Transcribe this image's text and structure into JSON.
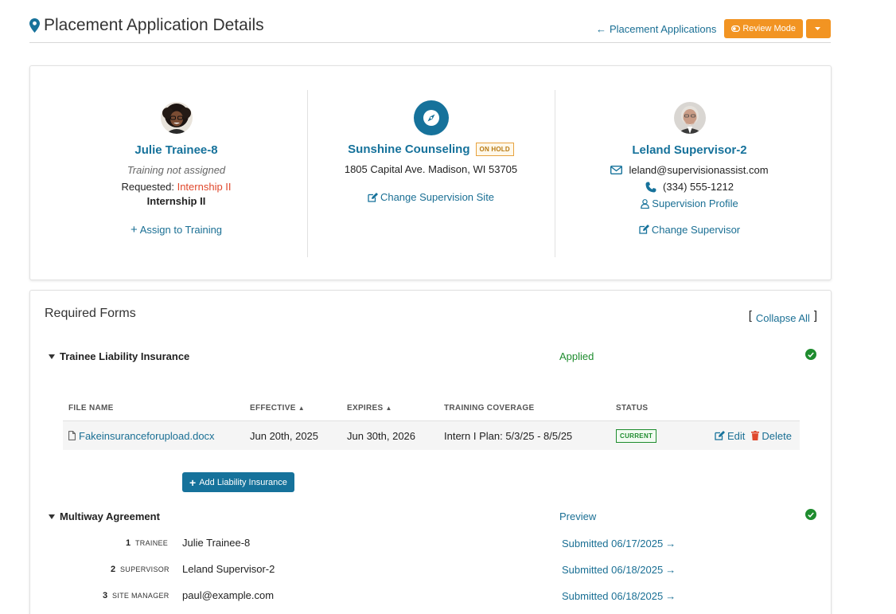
{
  "header": {
    "title": "Placement Application Details",
    "back_link": "Placement Applications",
    "review_mode_label": "Review Mode"
  },
  "trainee": {
    "name": "Julie Trainee-8",
    "training_status": "Training not assigned",
    "requested_label": "Requested:",
    "requested_value": "Internship II",
    "program": "Internship II",
    "assign_link": "Assign to Training"
  },
  "site": {
    "name": "Sunshine Counseling",
    "status_badge": "ON HOLD",
    "address": "1805 Capital Ave. Madison, WI 53705",
    "change_link": "Change Supervision Site"
  },
  "supervisor": {
    "name": "Leland Supervisor-2",
    "email": "leland@supervisionassist.com",
    "phone": "(334) 555-1212",
    "profile_link": "Supervision Profile",
    "change_link": "Change Supervisor"
  },
  "forms": {
    "title": "Required Forms",
    "collapse_all": "Collapse All",
    "liability": {
      "title": "Trainee Liability Insurance",
      "status": "Applied",
      "columns": [
        "FILE NAME",
        "EFFECTIVE",
        "EXPIRES",
        "TRAINING COVERAGE",
        "STATUS"
      ],
      "row": {
        "file_name": "Fakeinsuranceforupload.docx",
        "effective": "Jun 20th, 2025",
        "expires": "Jun 30th, 2026",
        "coverage": "Intern I Plan: 5/3/25 - 8/5/25",
        "status": "CURRENT",
        "edit": "Edit",
        "delete": "Delete"
      },
      "add_button": "Add Liability Insurance"
    },
    "agreement": {
      "title": "Multiway Agreement",
      "preview_link": "Preview",
      "signers": [
        {
          "num": "1",
          "role": "TRAINEE",
          "value": "Julie Trainee-8",
          "status": "Submitted 06/17/2025"
        },
        {
          "num": "2",
          "role": "SUPERVISOR",
          "value": "Leland Supervisor-2",
          "status": "Submitted 06/18/2025"
        },
        {
          "num": "3",
          "role": "SITE MANAGER",
          "value": "paul@example.com",
          "status": "Submitted 06/18/2025"
        }
      ]
    }
  },
  "colors": {
    "primary": "#16729b",
    "accent_orange": "#f29422",
    "success_green": "#1e8c2e",
    "requested_red": "#e0482c"
  },
  "icons": [
    "map-pin-icon",
    "arrow-left-icon",
    "eye-toggle-icon",
    "caret-down-icon",
    "plus-icon",
    "compass-icon",
    "edit-icon",
    "envelope-icon",
    "phone-icon",
    "user-icon",
    "check-circle-icon",
    "file-icon",
    "sort-icon",
    "trash-icon",
    "arrow-right-icon"
  ]
}
